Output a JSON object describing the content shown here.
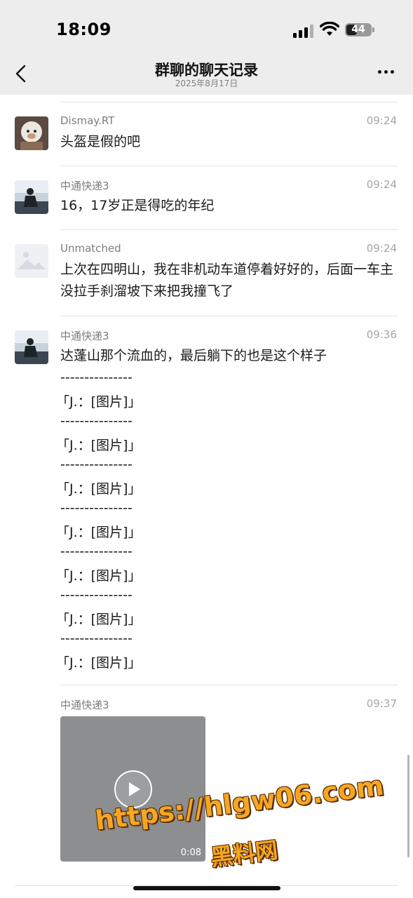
{
  "status_bar": {
    "time": "18:09",
    "battery": "44",
    "battery_level": 0.44
  },
  "nav": {
    "title": "群聊的聊天记录",
    "subtitle": "2025年8月17日"
  },
  "messages": [
    {
      "sender": "Dismay.RT",
      "time": "09:24",
      "text": "头盔是假的吧"
    },
    {
      "sender": "中通快递3",
      "time": "09:24",
      "text": "16，17岁正是得吃的年纪"
    },
    {
      "sender": "Unmatched",
      "time": "09:24",
      "text": "上次在四明山，我在非机动车道停着好好的，后面一车主没拉手刹溜坡下来把我撞飞了"
    },
    {
      "sender": "中通快递3",
      "time": "09:36",
      "text": "达蓬山那个流血的，最后躺下的也是这个样子",
      "lines": [
        "---------------",
        "「J.：[图片]」",
        "---------------",
        "「J.：[图片]」",
        "---------------",
        "「J.：[图片]」",
        "---------------",
        "「J.：[图片]」",
        "---------------",
        "「J.：[图片]」",
        "---------------",
        "「J.：[图片]」",
        "---------------",
        "「J.：[图片]」"
      ]
    },
    {
      "sender": "中通快递3",
      "time": "09:37",
      "video_duration": "0:08"
    }
  ],
  "watermark": {
    "url": "https://hlgw06.com",
    "label": "黑料网"
  },
  "colors": {
    "nav_bg": "#ededed",
    "watermark": "#f5a623"
  }
}
